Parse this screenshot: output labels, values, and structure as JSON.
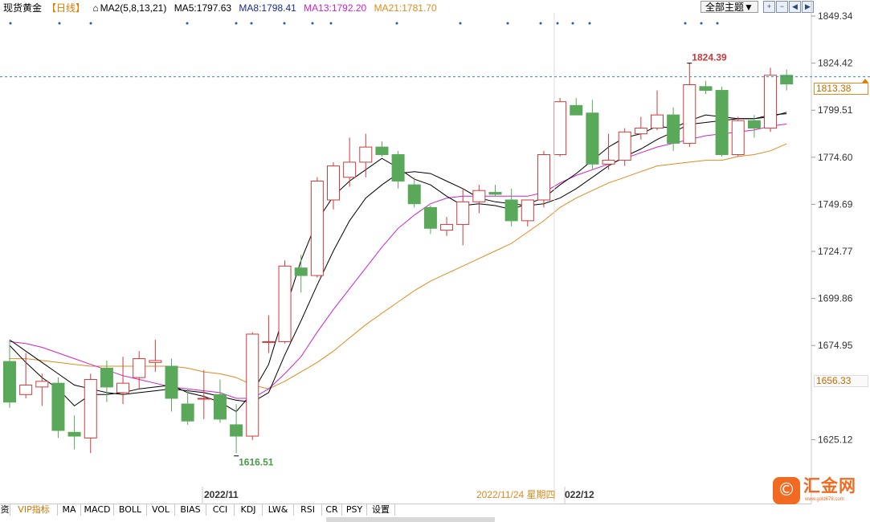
{
  "legend": {
    "symbol": "现货黄金",
    "timeframe": "【日线】",
    "ma_group": "MA2(5,8,13,21)",
    "ma5": "MA5:1797.63",
    "ma8": "MA8:1798.41",
    "ma13": "MA13:1792.20",
    "ma21": "MA21:1781.70"
  },
  "toolbar": {
    "theme_label": "全部主题▼",
    "btn_zoom_in": "+",
    "btn_zoom_out": "−",
    "btn_prev": "◀",
    "btn_next": "▶"
  },
  "price_tags": {
    "current": "1813.38",
    "lower": "1656.33"
  },
  "annotations": {
    "high_label": "1824.39",
    "low_label": "1616.51",
    "cursor_date": "2022/11/24 星期四",
    "month_nov": "2022/11",
    "month_dec": "022/12"
  },
  "tabs": [
    "资",
    "VIP指标",
    "MA",
    "MACD",
    "BOLL",
    "VOL",
    "BIAS",
    "CCI",
    "KDJ",
    "LW&",
    "RSI",
    "CR",
    "PSY",
    "设置"
  ],
  "logo": {
    "mark": "©",
    "name": "汇金网",
    "url": "www.gold678.com"
  },
  "colors": {
    "up": "#d23a3a",
    "down": "#5aa85a",
    "ma5": "#000000",
    "ma8": "#000000",
    "ma13": "#cc22cc",
    "ma21": "#e08a1e",
    "dashed": "#3b86b8",
    "accent": "#e07b00"
  },
  "chart_data": {
    "type": "candlestick",
    "title": "现货黄金",
    "timeframe": "日线",
    "y_ticks": [
      1849.34,
      1824.42,
      1799.51,
      1774.6,
      1749.69,
      1724.77,
      1699.86,
      1674.95,
      1625.12
    ],
    "ylim": [
      1604,
      1856
    ],
    "current_price": 1813.38,
    "tagged_price": 1656.33,
    "high_marker": 1824.39,
    "low_marker": 1616.51,
    "candles": [
      [
        1666.5,
        1678,
        1642,
        1645
      ],
      [
        1649,
        1671,
        1647,
        1654
      ],
      [
        1653,
        1660,
        1643,
        1656
      ],
      [
        1655,
        1658,
        1626,
        1630
      ],
      [
        1629,
        1638,
        1620,
        1627
      ],
      [
        1626,
        1660,
        1618,
        1657
      ],
      [
        1663,
        1667,
        1645,
        1653
      ],
      [
        1650,
        1669,
        1644,
        1655
      ],
      [
        1658,
        1672,
        1652,
        1668
      ],
      [
        1666,
        1678,
        1661,
        1667
      ],
      [
        1664,
        1668,
        1640,
        1647
      ],
      [
        1644,
        1652,
        1633,
        1635
      ],
      [
        1647,
        1662,
        1636,
        1647
      ],
      [
        1649,
        1657,
        1634,
        1636
      ],
      [
        1633,
        1644,
        1618,
        1627
      ],
      [
        1627,
        1682,
        1625,
        1681
      ],
      [
        1677,
        1691,
        1671,
        1677
      ],
      [
        1677,
        1720,
        1676,
        1717
      ],
      [
        1716,
        1723,
        1703,
        1712
      ],
      [
        1712,
        1764,
        1711,
        1762
      ],
      [
        1752,
        1772,
        1747,
        1770
      ],
      [
        1764,
        1785,
        1759,
        1772
      ],
      [
        1772,
        1787,
        1764,
        1780
      ],
      [
        1780,
        1783,
        1775,
        1776
      ],
      [
        1776,
        1778,
        1758,
        1762
      ],
      [
        1760,
        1764,
        1748,
        1750
      ],
      [
        1748,
        1749,
        1734,
        1737
      ],
      [
        1736,
        1743,
        1733,
        1739
      ],
      [
        1739,
        1758,
        1728,
        1751
      ],
      [
        1751,
        1760,
        1745,
        1757
      ],
      [
        1756,
        1760,
        1754,
        1755
      ],
      [
        1752,
        1758,
        1738,
        1741
      ],
      [
        1741,
        1752,
        1738,
        1752
      ],
      [
        1752,
        1778,
        1748,
        1776
      ],
      [
        1776,
        1806,
        1775,
        1804
      ],
      [
        1802,
        1806,
        1797,
        1797
      ],
      [
        1798,
        1805,
        1768,
        1771
      ],
      [
        1771,
        1787,
        1768,
        1773
      ],
      [
        1773,
        1790,
        1770,
        1788
      ],
      [
        1787,
        1796,
        1784,
        1790
      ],
      [
        1790,
        1810,
        1789,
        1797
      ],
      [
        1797,
        1801,
        1778,
        1782
      ],
      [
        1782,
        1824.39,
        1780,
        1813
      ],
      [
        1812,
        1815,
        1808,
        1810
      ],
      [
        1810,
        1812,
        1775,
        1776
      ],
      [
        1776,
        1796,
        1775,
        1794
      ],
      [
        1794,
        1797,
        1785,
        1790
      ],
      [
        1790,
        1822,
        1788,
        1818
      ],
      [
        1818,
        1821,
        1810,
        1813.38
      ]
    ],
    "ma5": [
      1675,
      1666,
      1658,
      1652,
      1643,
      1649,
      1649,
      1650,
      1652,
      1653,
      1654,
      1650,
      1648,
      1645,
      1640,
      1650,
      1665,
      1693,
      1720,
      1741,
      1754,
      1762,
      1768,
      1774,
      1769,
      1763,
      1760,
      1754,
      1749,
      1750,
      1749,
      1747,
      1750,
      1753,
      1760,
      1766,
      1773,
      1780,
      1785,
      1787,
      1791,
      1790,
      1794,
      1797,
      1796,
      1795,
      1795,
      1797,
      1797.63
    ],
    "ma8": [
      1678,
      1672,
      1666,
      1660,
      1654,
      1652,
      1650,
      1649,
      1650,
      1651,
      1652,
      1651,
      1650,
      1648,
      1646,
      1645,
      1650,
      1670,
      1688,
      1707,
      1725,
      1741,
      1753,
      1760,
      1766,
      1767,
      1766,
      1762,
      1758,
      1753,
      1751,
      1750,
      1749,
      1750,
      1753,
      1758,
      1764,
      1770,
      1775,
      1779,
      1784,
      1788,
      1792,
      1793,
      1794,
      1795,
      1795,
      1796,
      1798.41
    ],
    "ma13": [
      1677,
      1676,
      1674,
      1671,
      1668,
      1665,
      1662,
      1659,
      1657,
      1655,
      1653,
      1652,
      1651,
      1650,
      1647,
      1647,
      1652,
      1660,
      1669,
      1682,
      1694,
      1705,
      1716,
      1727,
      1737,
      1744,
      1750,
      1753,
      1754,
      1754,
      1754,
      1754,
      1754,
      1756,
      1761,
      1765,
      1768,
      1771,
      1774,
      1777,
      1780,
      1782,
      1784,
      1786,
      1787,
      1788,
      1789,
      1791,
      1792.2
    ],
    "ma21": [
      1668,
      1668,
      1667,
      1666,
      1665,
      1664,
      1664,
      1664,
      1664,
      1664,
      1664,
      1663,
      1661,
      1660,
      1658,
      1654,
      1652,
      1656,
      1661,
      1666,
      1672,
      1679,
      1686,
      1692,
      1698,
      1704,
      1709,
      1713,
      1717,
      1721,
      1725,
      1729,
      1735,
      1741,
      1748,
      1753,
      1757,
      1761,
      1764,
      1767,
      1770,
      1771,
      1772,
      1773,
      1773,
      1775,
      1776,
      1778,
      1781.7
    ]
  }
}
